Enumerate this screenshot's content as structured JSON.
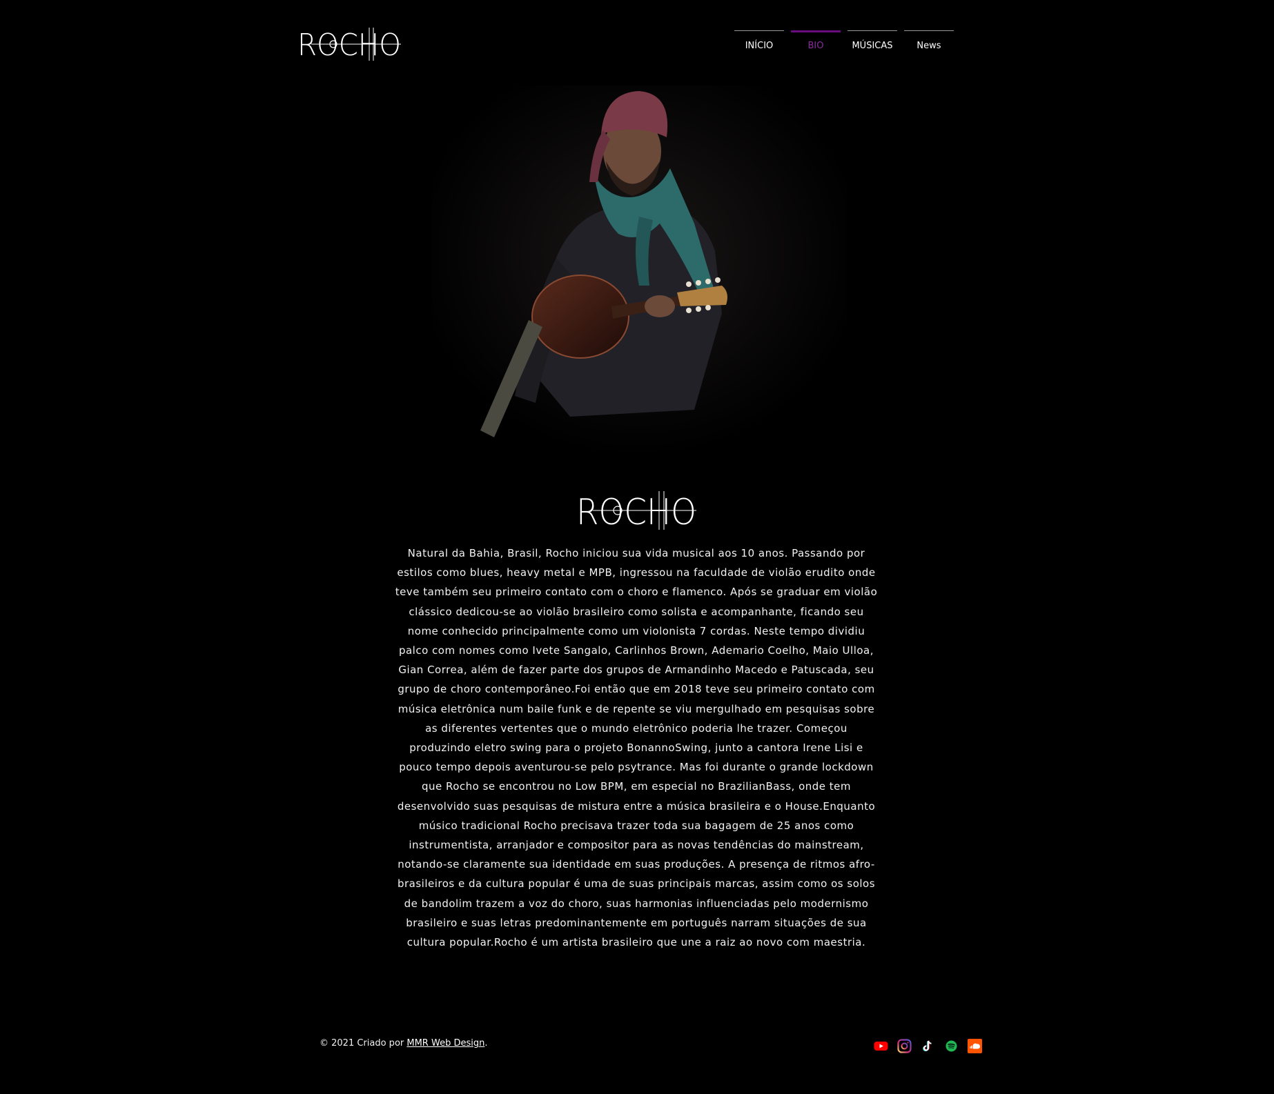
{
  "header": {
    "logo_text": "ROCHO",
    "nav": [
      {
        "label": "INÍCIO",
        "active": false
      },
      {
        "label": "BIO",
        "active": true
      },
      {
        "label": "MÚSICAS",
        "active": false
      },
      {
        "label": "News",
        "active": false
      }
    ]
  },
  "hero": {
    "image_alt": "Rocho tocando bandolim"
  },
  "bio": {
    "logo_text": "ROCHO",
    "text": "Natural da Bahia, Brasil, Rocho iniciou sua vida musical aos 10 anos. Passando por estilos como blues, heavy metal e MPB, ingressou na faculdade de violão erudito onde teve também seu primeiro contato com o choro e flamenco. Após se graduar em violão clássico dedicou-se ao violão brasileiro como solista e acompanhante, ficando seu nome conhecido principalmente como um violonista 7 cordas. Neste tempo dividiu palco com nomes como Ivete Sangalo, Carlinhos Brown, Ademario Coelho, Maio Ulloa, Gian Correa, além de fazer parte dos grupos de Armandinho Macedo e Patuscada, seu grupo de choro contemporâneo.Foi então que em 2018 teve seu primeiro contato com música eletrônica num baile funk e de repente se viu mergulhado em pesquisas sobre as diferentes vertentes que o mundo eletrônico poderia lhe trazer. Começou produzindo eletro swing para o projeto BonannoSwing, junto a cantora Irene Lisi e pouco tempo depois aventurou-se pelo psytrance. Mas foi durante o grande lockdown que Rocho se encontrou no Low BPM, em especial no BrazilianBass, onde tem desenvolvido suas pesquisas de mistura entre a música brasileira e o House.Enquanto músico tradicional Rocho precisava trazer toda sua bagagem de 25 anos como instrumentista, arranjador e compositor para as novas tendências do mainstream, notando-se claramente sua identidade em suas produções. A presença de ritmos afro-brasileiros e da cultura popular é uma de suas principais marcas, assim como os solos de bandolim trazem a voz do choro, suas harmonias influenciadas pelo modernismo brasileiro e suas letras predominantemente em português narram situações de sua cultura popular.Rocho é um artista brasileiro que une a raiz ao novo com maestria."
  },
  "footer": {
    "copyright_prefix": "© 2021 Criado por ",
    "link_text": "MMR Web Design",
    "copyright_suffix": ".",
    "social": [
      {
        "name": "youtube-icon",
        "color": "#ff0000"
      },
      {
        "name": "instagram-icon",
        "color": "#d6249f"
      },
      {
        "name": "tiktok-icon",
        "color": "#ffffff"
      },
      {
        "name": "spotify-icon",
        "color": "#1db954"
      },
      {
        "name": "soundcloud-icon",
        "color": "#ff5500"
      }
    ]
  }
}
